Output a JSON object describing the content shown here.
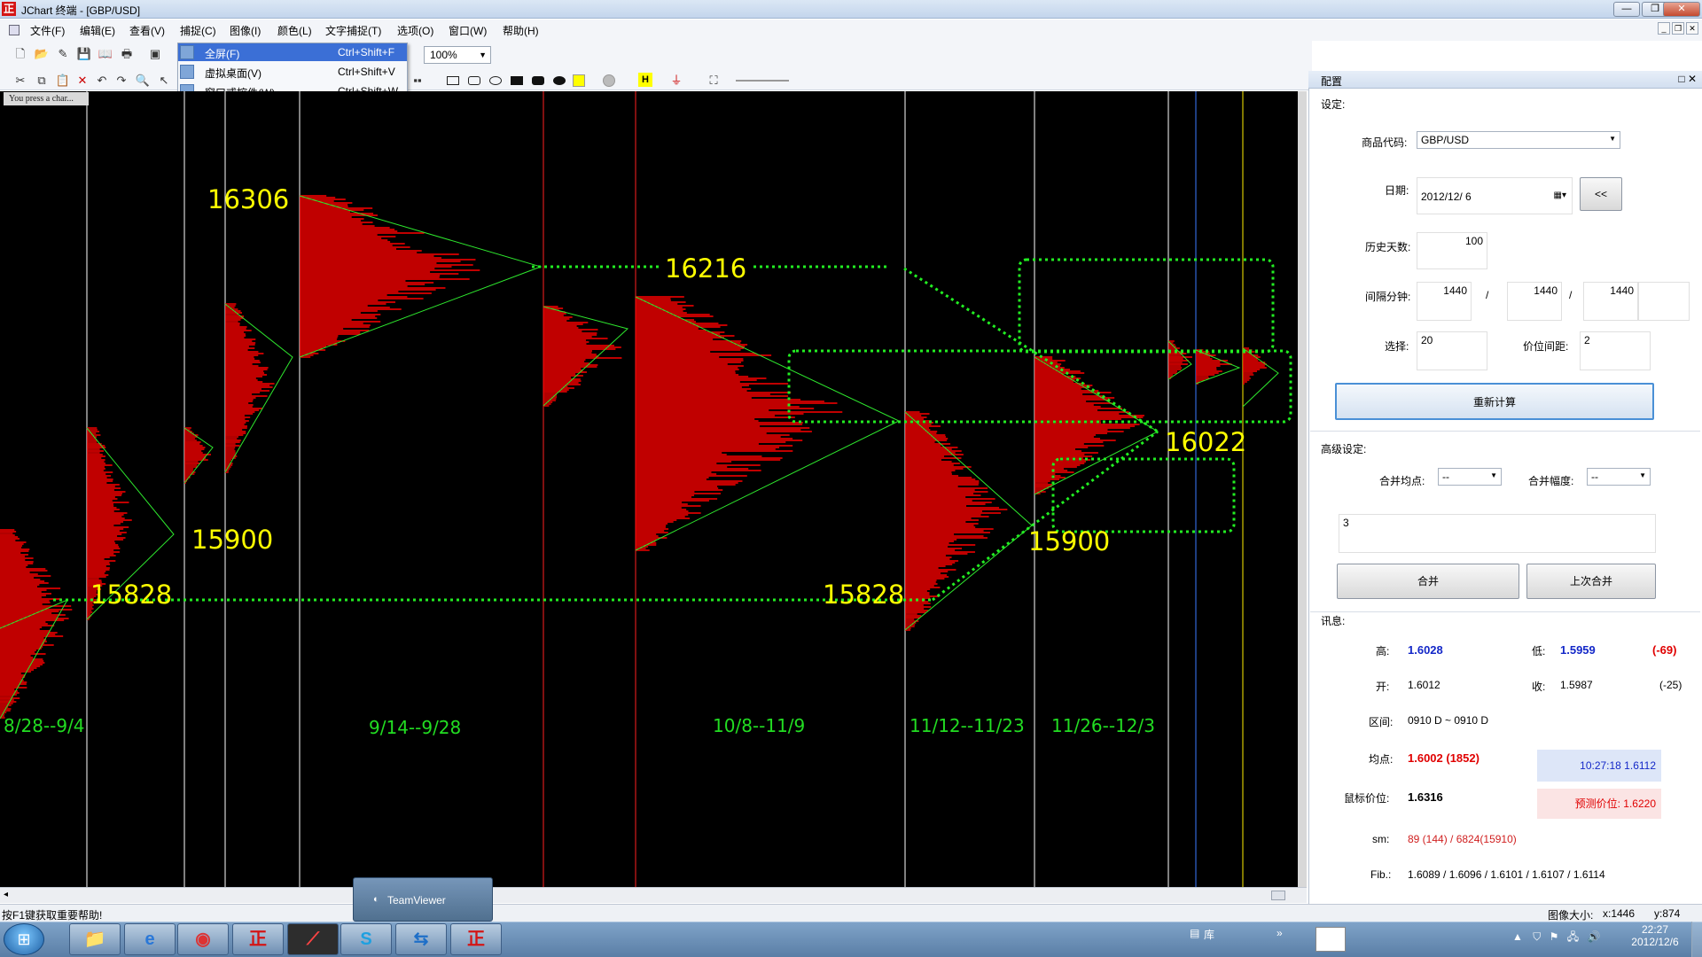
{
  "window": {
    "title": "JChart 终端 - [GBP/USD]",
    "app_icon": "正"
  },
  "menu": {
    "items": [
      "文件(F)",
      "编辑(E)",
      "查看(V)",
      "捕捉(C)",
      "图像(I)",
      "颜色(L)",
      "文字捕捉(T)",
      "选项(O)",
      "窗口(W)",
      "帮助(H)"
    ]
  },
  "toolbar": {
    "zoom": "100%"
  },
  "dropdown": {
    "items": [
      {
        "label": "全屏(F)",
        "shortcut": "Ctrl+Shift+F"
      },
      {
        "label": "虚拟桌面(V)",
        "shortcut": "Ctrl+Shift+V"
      },
      {
        "label": "窗口或控件(W)",
        "shortcut": "Ctrl+Shift+W"
      }
    ]
  },
  "chart": {
    "tooltip": "You press a char...",
    "levels": [
      "16306",
      "16216",
      "15900",
      "15828",
      "15900",
      "15828",
      "16022"
    ],
    "date_ranges": [
      "8/28--9/4",
      "9/14--9/28",
      "10/8--11/9",
      "11/12--11/23",
      "11/26--12/3"
    ],
    "colors": {
      "profile": "#ff0000",
      "triangle": "#2ee82e",
      "level_text": "#ffff00",
      "date_text": "#22dd22",
      "dotted": "#22ee22"
    }
  },
  "panel": {
    "title": "配置",
    "section_settings": "设定:",
    "symbol_label": "商品代码:",
    "symbol_value": "GBP/USD",
    "date_label": "日期:",
    "date_value": "2012/12/  6",
    "prev_button": "<<",
    "history_label": "历史天数:",
    "history_value": "100",
    "interval_label": "间隔分钟:",
    "interval_1": "1440",
    "interval_sep1": "/",
    "interval_2": "1440",
    "interval_sep2": "/",
    "interval_3": "1440",
    "select_label": "选择:",
    "select_value": "20",
    "tick_label": "价位间距:",
    "tick_value": "2",
    "recalc_button": "重新计算",
    "section_advanced": "高级设定:",
    "merge_avg_label": "合并均点:",
    "merge_avg_value": "--",
    "merge_range_label": "合并幅度:",
    "merge_range_value": "--",
    "merge_text": "3",
    "merge_button": "合并",
    "last_merge_button": "上次合并",
    "section_info": "讯息:",
    "high_label": "高:",
    "high_value": "1.6028",
    "low_label": "低:",
    "low_value": "1.5959",
    "range_diff": "(-69)",
    "open_label": "开:",
    "open_value": "1.6012",
    "close_label": "收:",
    "close_value": "1.5987",
    "close_diff": "(-25)",
    "interval_info_label": "区间:",
    "interval_info_value": "0910 D ~ 0910 D",
    "avg_label": "均点:",
    "avg_value": "1.6002 (1852)",
    "time_price": "10:27:18  1.6112",
    "mouse_label": "鼠标价位:",
    "mouse_value": "1.6316",
    "predict": "预测价位: 1.6220",
    "sm_label": "sm:",
    "sm_value": "89 (144) / 6824(15910)",
    "fib_label": "Fib.:",
    "fib_value": "1.6089 / 1.6096 / 1.6101 / 1.6107 / 1.6114"
  },
  "statusbar": {
    "help": "按F1键获取重要帮助!",
    "image_size_label": "图像大小:",
    "x": "x:1446",
    "y": "y:874"
  },
  "taskbar": {
    "teamviewer": "TeamViewer",
    "library": "库",
    "time": "22:27",
    "date": "2012/12/6"
  }
}
